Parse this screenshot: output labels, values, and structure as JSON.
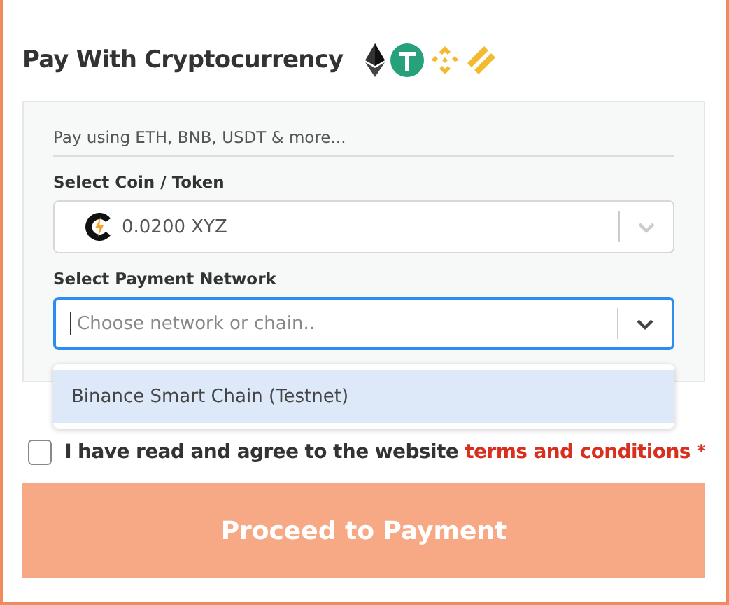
{
  "title": "Pay With Cryptocurrency",
  "panel": {
    "hint": "Pay using ETH, BNB, USDT & more...",
    "coin": {
      "label": "Select Coin / Token",
      "value": "0.0200 XYZ"
    },
    "network": {
      "label": "Select Payment Network",
      "placeholder": "Choose network or chain..",
      "focused": true,
      "expanded": true,
      "options": [
        {
          "label": "Binance Smart Chain (Testnet)",
          "selected": true
        }
      ]
    }
  },
  "agree": {
    "text": "I have read and agree to the website",
    "link": "terms and conditions",
    "required": "*",
    "checked": false
  },
  "button": {
    "label": "Proceed to Payment",
    "disabled": true
  }
}
